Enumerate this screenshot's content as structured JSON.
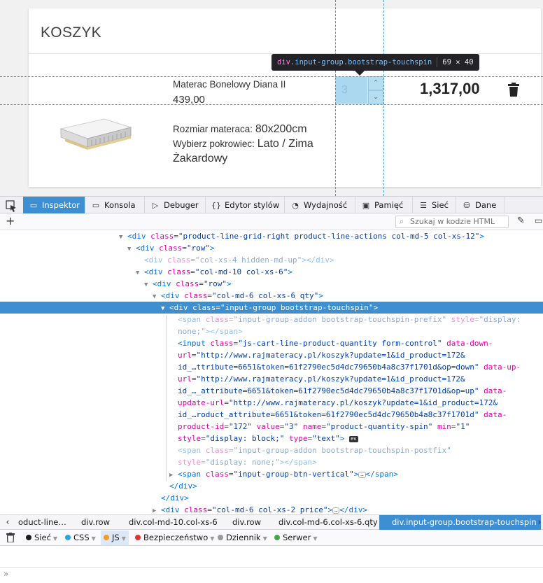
{
  "cart": {
    "title": "KOSZYK",
    "product": {
      "name": "Materac Bonelowy Diana II",
      "price": "439,00",
      "attr1_label": "Rozmiar materaca:",
      "attr1_value": "80x200cm",
      "attr2_label": "Wybierz pokrowiec:",
      "attr2_value": "Lato / Zima Żakardowy",
      "quantity": "3",
      "line_total": "1,317,00",
      "image_icon": "mattress-image",
      "delete_icon": "trash-icon"
    }
  },
  "highlighter": {
    "tag": "div",
    "classes": ".input-group.bootstrap-touchspin",
    "size": "69 × 40"
  },
  "devtools": {
    "tabs": [
      {
        "label": "Inspektor",
        "icon": "inspector-icon"
      },
      {
        "label": "Konsola",
        "icon": "console-icon"
      },
      {
        "label": "Debuger",
        "icon": "debugger-icon"
      },
      {
        "label": "Edytor stylów",
        "icon": "style-editor-icon"
      },
      {
        "label": "Wydajność",
        "icon": "performance-icon"
      },
      {
        "label": "Pamięć",
        "icon": "memory-icon"
      },
      {
        "label": "Sieć",
        "icon": "network-icon"
      },
      {
        "label": "Dane",
        "icon": "storage-icon"
      }
    ],
    "active_tab": "Inspektor",
    "search_placeholder": "Szukaj w kodzie HTML",
    "markup": {
      "l1_class": "product-line-grid-right product-line-actions col-md-5 col-xs-12",
      "l2_class": "row",
      "l3_class": "col-xs-4 hidden-md-up",
      "l4_class": "col-md-10 col-xs-6",
      "l5_class": "row",
      "l6_class": "col-md-6 col-xs-6 qty",
      "l7_class": "input-group bootstrap-touchspin",
      "l8_class": "input-group-addon bootstrap-touchspin-prefix",
      "l8_style_a": "display:",
      "l8_style_b": "none;",
      "input_class": "js-cart-line-product-quantity form-control",
      "down_url_a": "http://www.rajmateracy.pl/koszyk?update=1&id_product=172&",
      "down_url_b": "id_…ttribute=6651&token=61f2790ec5d4dc79650b4a8c37f1701d&op=down",
      "up_url_a": "http://www.rajmateracy.pl/koszyk?update=1&id_product=172&",
      "up_url_b": "id_…_attribute=6651&token=61f2790ec5d4dc79650b4a8c37f1701d&op=up",
      "update_url_a": "http://www.rajmateracy.pl/koszyk?update=1&id_product=172&",
      "update_url_b": "id_…roduct_attribute=6651&token=61f2790ec5d4dc79650b4a8c37f1701d",
      "product_id": "172",
      "value": "3",
      "name": "product-quantity-spin",
      "min": "1",
      "style": "display: block;",
      "type": "text",
      "ev_badge": "ev",
      "postfix_class": "input-group-addon bootstrap-touchspin-postfix",
      "postfix_style": "display: none;",
      "btn_vertical_class": "input-group-btn-vertical",
      "price_class": "col-md-6 col-xs-2 price"
    },
    "breadcrumbs": [
      "oduct-line…",
      "div.row",
      "div.col-md-10.col-xs-6",
      "div.row",
      "div.col-md-6.col-xs-6.qty",
      "div.input-group.bootstrap-touchspin"
    ],
    "console_filters": [
      {
        "label": "Sieć",
        "color": "#1b1b1b"
      },
      {
        "label": "CSS",
        "color": "#29a7e1"
      },
      {
        "label": "JS",
        "color": "#f39c24"
      },
      {
        "label": "Bezpieczeństwo",
        "color": "#e3342f"
      },
      {
        "label": "Dziennik",
        "color": "#9a9a9a"
      },
      {
        "label": "Serwer",
        "color": "#4aa64a"
      }
    ],
    "console_prompt": "»"
  }
}
